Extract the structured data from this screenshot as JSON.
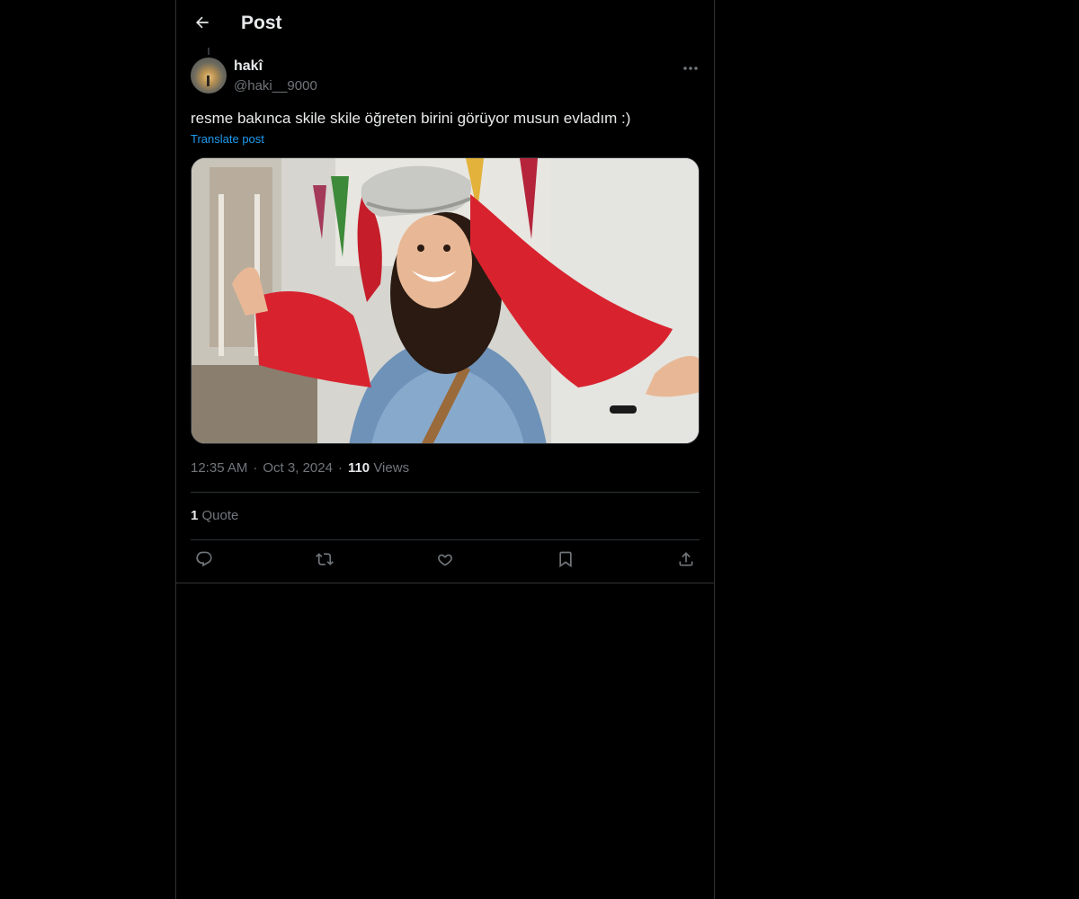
{
  "header": {
    "title": "Post"
  },
  "post": {
    "author": {
      "display_name": "hakî",
      "handle": "@haki__9000"
    },
    "text": "resme bakınca skile skile öğreten birini görüyor musun evladım :)",
    "translate_label": "Translate post",
    "time": "12:35 AM",
    "date": "Oct 3, 2024",
    "views_count": "110",
    "views_label": "Views",
    "separator": "·",
    "quotes_count": "1",
    "quotes_label": "Quote"
  },
  "icons": {
    "back": "arrow-left-icon",
    "more": "more-horizontal-icon",
    "reply": "reply-icon",
    "repost": "repost-icon",
    "like": "heart-icon",
    "bookmark": "bookmark-icon",
    "share": "share-icon"
  },
  "colors": {
    "background": "#000000",
    "text": "#e7e9ea",
    "secondary": "#71767b",
    "accent": "#1d9bf0",
    "border": "#2f3336"
  }
}
